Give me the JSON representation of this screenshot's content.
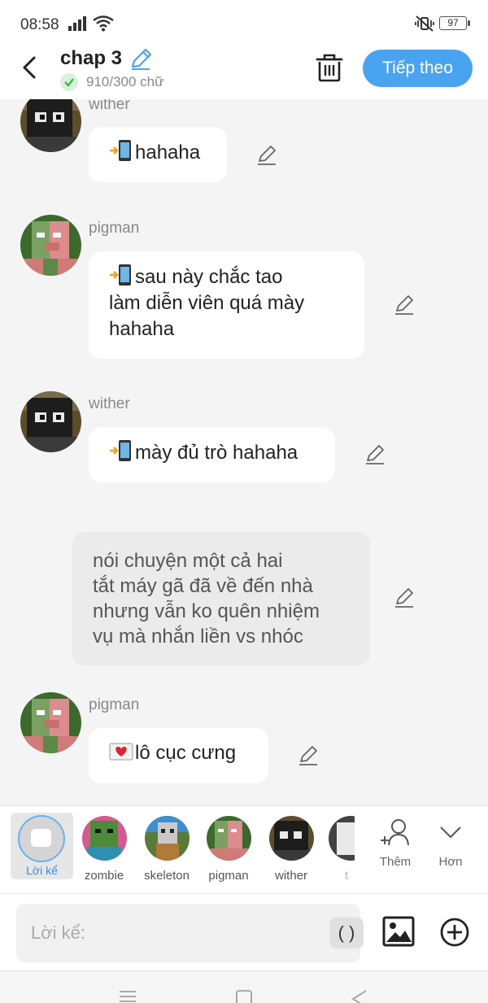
{
  "status": {
    "time": "08:58",
    "battery": "97"
  },
  "header": {
    "title": "chap 3",
    "word_count": "910/300 chữ",
    "next_label": "Tiếp theo"
  },
  "messages": [
    {
      "type": "character",
      "name": "wither",
      "text": "hahaha",
      "icon": "phone-icon"
    },
    {
      "type": "character",
      "name": "pigman",
      "lines": [
        "sau này chắc tao",
        "làm diễn viên quá mày",
        "hahaha"
      ],
      "icon": "phone-icon"
    },
    {
      "type": "character",
      "name": "wither",
      "text": "mày đủ trò hahaha",
      "icon": "phone-icon"
    },
    {
      "type": "narration",
      "lines": [
        "nói chuyện một cả hai",
        "tắt máy gã đã về đến nhà",
        "nhưng vẫn ko quên nhiệm",
        "vụ mà nhắn liền vs nhóc"
      ]
    },
    {
      "type": "character",
      "name": "pigman",
      "text": "lô cục cưng",
      "icon": "love-letter-icon"
    }
  ],
  "characters": {
    "narrator": "Lời kể",
    "list": [
      "zombie",
      "skeleton",
      "pigman",
      "wither",
      "t"
    ],
    "more_label": "Thêm",
    "expand_label": "Hơn"
  },
  "input": {
    "placeholder": "Lời kể:",
    "paren_label": "( )"
  },
  "colors": {
    "accent": "#4aa3f0",
    "check": "#3fb65a",
    "bubble": "#ffffff",
    "narration": "#ebebeb"
  }
}
